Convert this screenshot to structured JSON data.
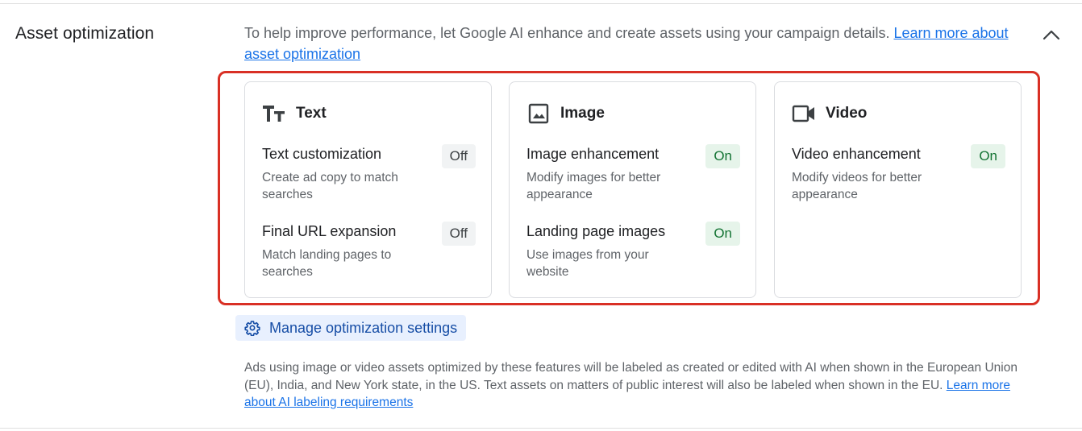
{
  "section": {
    "title": "Asset optimization"
  },
  "intro": {
    "text": "To help improve performance, let Google AI enhance and create assets using your campaign details. ",
    "link": "Learn more about asset optimization"
  },
  "cards": [
    {
      "title": "Text",
      "icon": "text-format-icon",
      "features": [
        {
          "title": "Text customization",
          "desc": "Create ad copy to match searches",
          "status": "Off"
        },
        {
          "title": "Final URL expansion",
          "desc": "Match landing pages to searches",
          "status": "Off"
        }
      ]
    },
    {
      "title": "Image",
      "icon": "image-icon",
      "features": [
        {
          "title": "Image enhancement",
          "desc": "Modify images for better appearance",
          "status": "On"
        },
        {
          "title": "Landing page images",
          "desc": "Use images from your website",
          "status": "On"
        }
      ]
    },
    {
      "title": "Video",
      "icon": "video-camera-icon",
      "features": [
        {
          "title": "Video enhancement",
          "desc": "Modify videos for better appearance",
          "status": "On"
        }
      ]
    }
  ],
  "manage": {
    "label": "Manage optimization settings",
    "icon": "gear-icon"
  },
  "footnote": {
    "text": "Ads using image or video assets optimized by these features will be labeled as created or edited with AI when shown in the European Union (EU), India, and New York state, in the US. Text assets on matters of public interest will also be labeled when shown in the EU. ",
    "link": "Learn more about AI labeling requirements"
  },
  "colors": {
    "link": "#1a73e8",
    "highlight_border": "#d93025",
    "on_chip_bg": "#e6f4ea",
    "on_chip_text": "#137333",
    "off_chip_bg": "#f1f3f4",
    "manage_bg": "#e8f0fe",
    "manage_text": "#174ea6"
  }
}
